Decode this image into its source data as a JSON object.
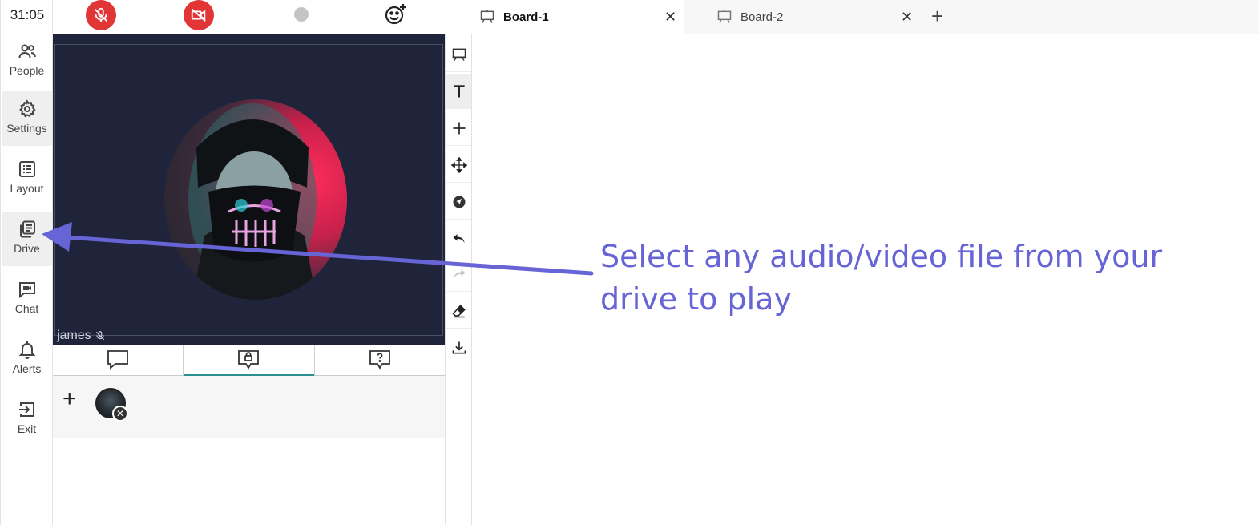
{
  "timer": "31:05",
  "nav": {
    "people": "People",
    "settings": "Settings",
    "layout": "Layout",
    "drive": "Drive",
    "chat": "Chat",
    "alerts": "Alerts",
    "exit": "Exit"
  },
  "video": {
    "participant_name": "james"
  },
  "boards": {
    "tab1": "Board-1",
    "tab2": "Board-2",
    "close_glyph": "✕",
    "add_glyph": "+"
  },
  "participants": {
    "add_glyph": "+",
    "remove_glyph": "✕"
  },
  "annotation": {
    "text": "Select any audio/video file from your drive to play"
  },
  "colors": {
    "annotation": "#6764d6",
    "mute_button": "#e23636",
    "video_bg": "#20243a",
    "active_tab_underline": "#2a8f8f"
  },
  "icons": {
    "nav": [
      "people-icon",
      "gear-icon",
      "list-icon",
      "drive-icon",
      "chat-video-icon",
      "bell-icon",
      "exit-icon"
    ],
    "top_bar": [
      "mic-off-icon",
      "video-off-icon",
      "record-dot-icon",
      "emoji-add-icon"
    ],
    "chat_tabs": [
      "chat-bubble-icon",
      "private-chat-lock-icon",
      "question-bubble-icon"
    ],
    "tools": [
      "presentation-icon",
      "text-icon",
      "plus-icon",
      "move-icon",
      "pointer-icon",
      "undo-icon",
      "redo-icon",
      "eraser-icon",
      "download-icon"
    ]
  }
}
